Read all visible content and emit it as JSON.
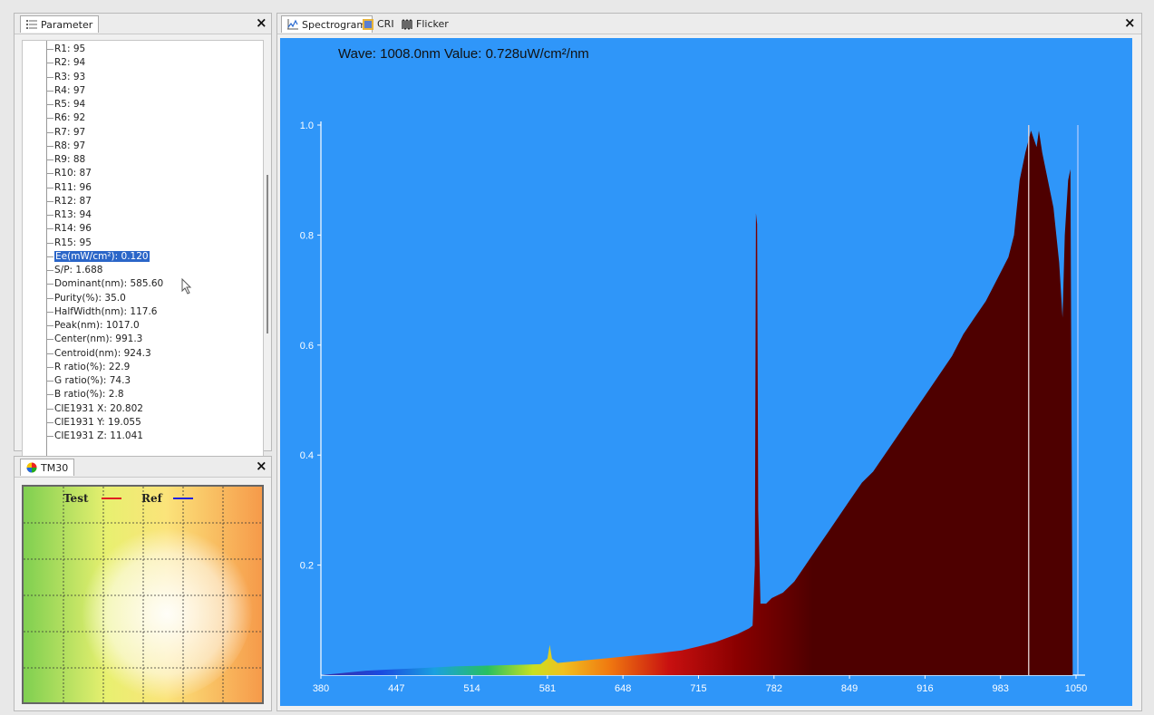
{
  "parameter_panel": {
    "tab_label": "Parameter",
    "items": [
      "R1: 95",
      "R2: 94",
      "R3: 93",
      "R4: 97",
      "R5: 94",
      "R6: 92",
      "R7: 97",
      "R8: 97",
      "R9: 88",
      "R10: 87",
      "R11: 96",
      "R12: 87",
      "R13: 94",
      "R14: 96",
      "R15: 95",
      "Ee(mW/cm²): 0.120",
      "S/P: 1.688",
      "Dominant(nm): 585.60",
      "Purity(%): 35.0",
      "HalfWidth(nm): 117.6",
      "Peak(nm): 1017.0",
      "Center(nm): 991.3",
      "Centroid(nm): 924.3",
      "R ratio(%): 22.9",
      "G ratio(%): 74.3",
      "B ratio(%): 2.8",
      "CIE1931 X: 20.802",
      "CIE1931 Y: 19.055",
      "CIE1931 Z: 11.041"
    ],
    "selected_index": 15
  },
  "tm30_panel": {
    "tab_label": "TM30",
    "legend_test": "Test",
    "legend_ref": "Ref",
    "test_color": "#e02020",
    "ref_color": "#2020e0"
  },
  "spectrogram_panel": {
    "tabs": [
      "Spectrogram",
      "CRI",
      "Flicker"
    ],
    "readout": "Wave: 1008.0nm Value: 0.728uW/cm²/nm"
  },
  "chart_data": {
    "type": "area",
    "title": "",
    "xlabel": "",
    "ylabel": "",
    "xlim": [
      380,
      1050
    ],
    "ylim": [
      0,
      1.0
    ],
    "xticks": [
      "380",
      "447",
      "514",
      "581",
      "648",
      "715",
      "782",
      "849",
      "916",
      "983",
      "1050"
    ],
    "yticks": [
      "0.2",
      "0.4",
      "0.6",
      "0.8",
      "1.0"
    ],
    "background_color": "#2f96f9",
    "fill_color_ir": "#4e0000",
    "cursor_x": 1008.0,
    "series": [
      {
        "x": [
          380,
          400,
          420,
          440,
          460,
          480,
          500,
          520,
          540,
          560,
          575,
          581,
          583,
          585,
          590,
          600,
          620,
          640,
          660,
          680,
          700,
          715,
          730,
          750,
          760,
          763,
          765,
          766,
          767,
          768,
          770,
          775,
          780,
          790,
          800,
          810,
          820,
          830,
          840,
          850,
          860,
          870,
          880,
          890,
          900,
          910,
          920,
          930,
          940,
          950,
          960,
          970,
          980,
          990,
          995,
          1000,
          1005,
          1010,
          1015,
          1017,
          1020,
          1025,
          1030,
          1035,
          1038,
          1040,
          1043,
          1045,
          1047
        ],
        "y": [
          0.0,
          0.004,
          0.008,
          0.01,
          0.012,
          0.014,
          0.016,
          0.017,
          0.018,
          0.019,
          0.02,
          0.03,
          0.055,
          0.03,
          0.022,
          0.024,
          0.028,
          0.032,
          0.036,
          0.04,
          0.045,
          0.052,
          0.06,
          0.075,
          0.085,
          0.09,
          0.2,
          0.84,
          0.82,
          0.3,
          0.13,
          0.13,
          0.14,
          0.15,
          0.17,
          0.2,
          0.23,
          0.26,
          0.29,
          0.32,
          0.35,
          0.37,
          0.4,
          0.43,
          0.46,
          0.49,
          0.52,
          0.55,
          0.58,
          0.62,
          0.65,
          0.68,
          0.72,
          0.76,
          0.8,
          0.9,
          0.95,
          0.99,
          0.96,
          0.99,
          0.95,
          0.9,
          0.85,
          0.75,
          0.65,
          0.8,
          0.9,
          0.92,
          0.0
        ]
      }
    ]
  }
}
